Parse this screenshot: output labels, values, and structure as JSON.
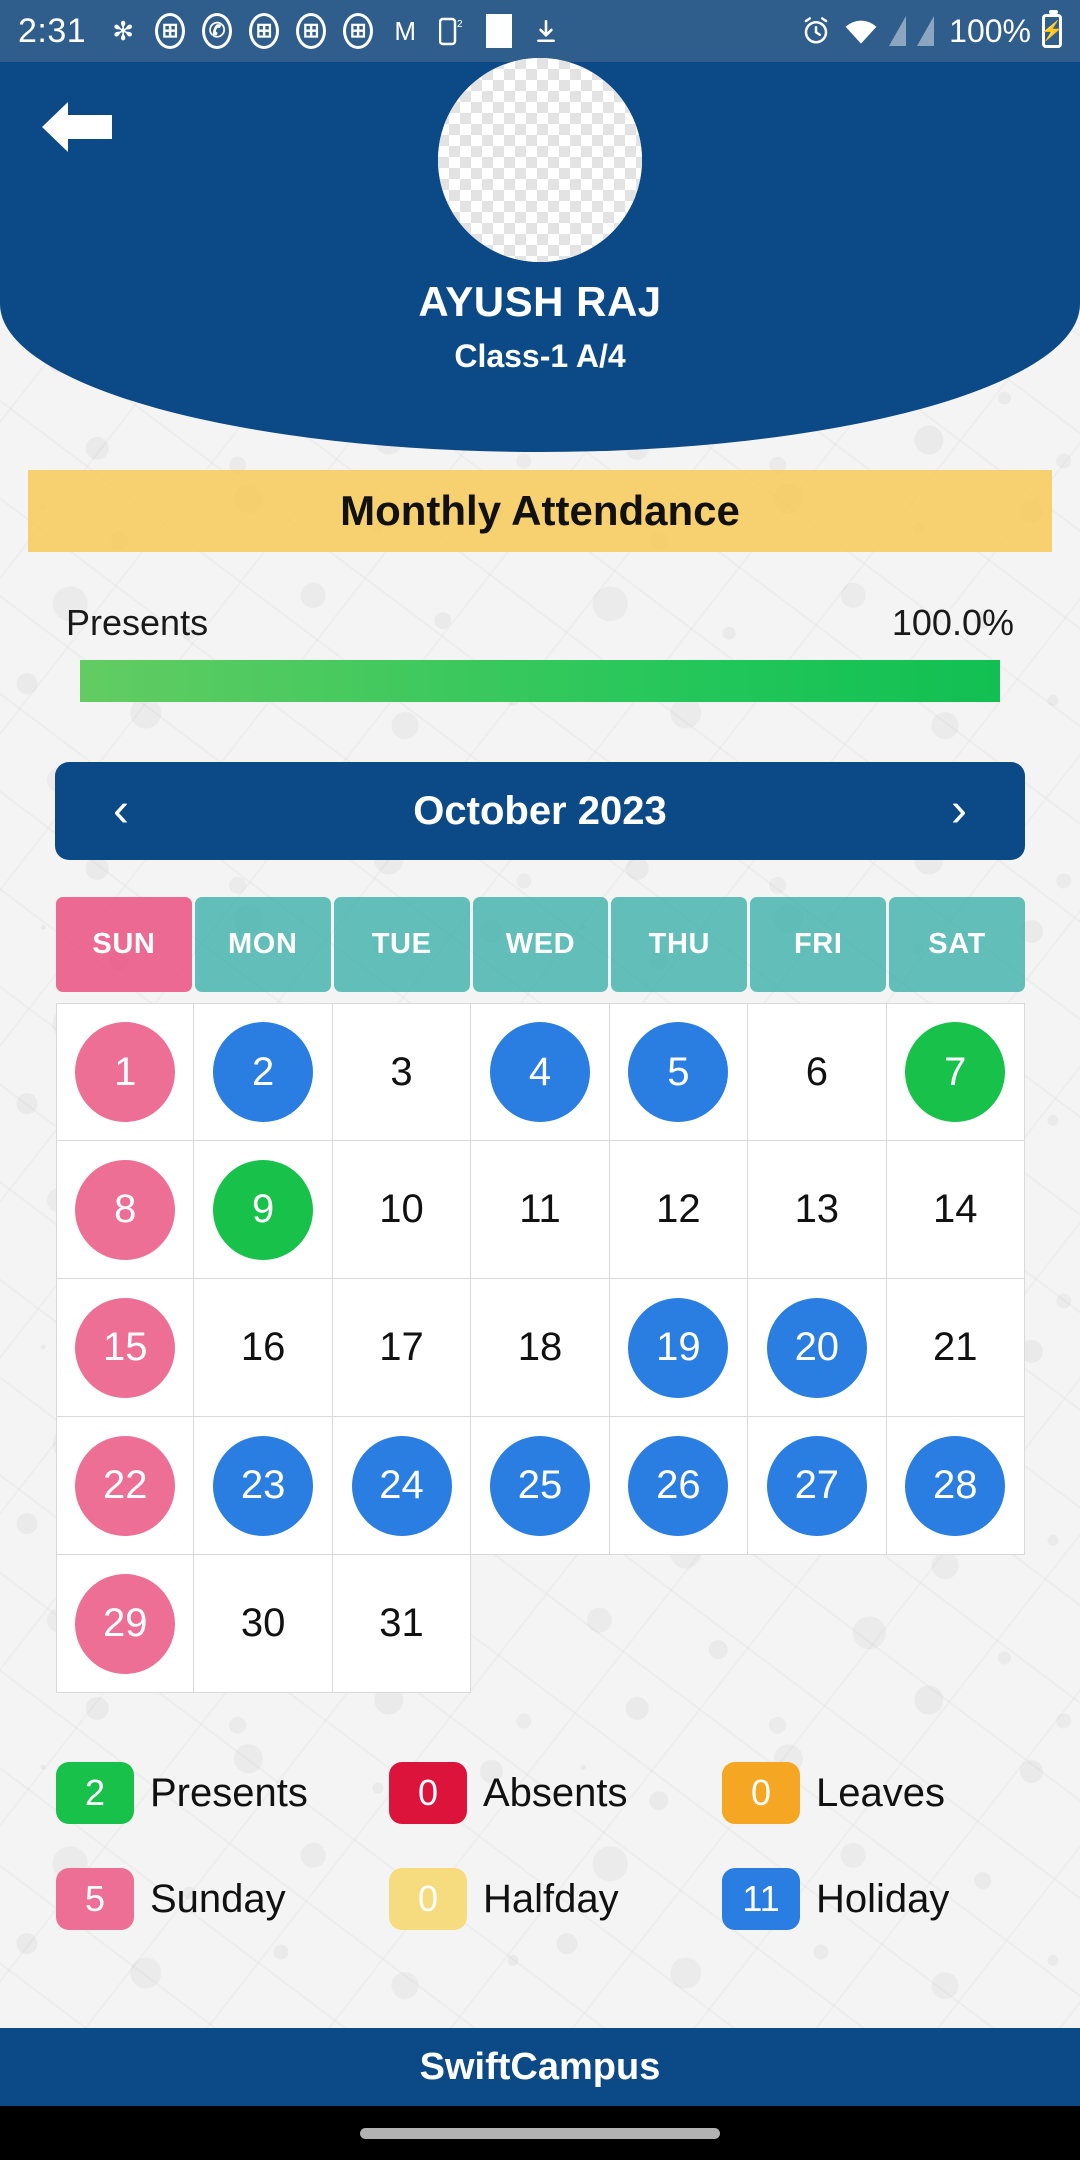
{
  "statusbar": {
    "clock": "2:31",
    "battery_percent": "100%",
    "icons": [
      "slack-icon",
      "app-oval-icon",
      "whatsapp-icon",
      "app-oval-icon",
      "app-oval-icon",
      "app-oval-icon",
      "gmail-icon",
      "exit-badge-icon",
      "white-square-icon",
      "download-icon",
      "alarm-icon",
      "wifi-icon",
      "signal-bar-icon",
      "signal-bar-icon",
      "battery-icon"
    ]
  },
  "header": {
    "back_icon": "back-arrow-icon",
    "avatar_alt": "student-photo",
    "student_name": "AYUSH RAJ",
    "student_class": "Class-1 A/4"
  },
  "banner": {
    "title": "Monthly Attendance"
  },
  "attendance": {
    "label": "Presents",
    "percent_text": "100.0%",
    "percent_value": 100
  },
  "month_nav": {
    "prev_icon": "chevron-left-icon",
    "next_icon": "chevron-right-icon",
    "month_label": "October 2023"
  },
  "calendar": {
    "day_headers": [
      "SUN",
      "MON",
      "TUE",
      "WED",
      "THU",
      "FRI",
      "SAT"
    ],
    "weeks": [
      [
        {
          "day": "1",
          "status": "sunday"
        },
        {
          "day": "2",
          "status": "holiday"
        },
        {
          "day": "3",
          "status": "none"
        },
        {
          "day": "4",
          "status": "holiday"
        },
        {
          "day": "5",
          "status": "holiday"
        },
        {
          "day": "6",
          "status": "none"
        },
        {
          "day": "7",
          "status": "present"
        }
      ],
      [
        {
          "day": "8",
          "status": "sunday"
        },
        {
          "day": "9",
          "status": "present"
        },
        {
          "day": "10",
          "status": "none"
        },
        {
          "day": "11",
          "status": "none"
        },
        {
          "day": "12",
          "status": "none"
        },
        {
          "day": "13",
          "status": "none"
        },
        {
          "day": "14",
          "status": "none"
        }
      ],
      [
        {
          "day": "15",
          "status": "sunday"
        },
        {
          "day": "16",
          "status": "none"
        },
        {
          "day": "17",
          "status": "none"
        },
        {
          "day": "18",
          "status": "none"
        },
        {
          "day": "19",
          "status": "holiday"
        },
        {
          "day": "20",
          "status": "holiday"
        },
        {
          "day": "21",
          "status": "none"
        }
      ],
      [
        {
          "day": "22",
          "status": "sunday"
        },
        {
          "day": "23",
          "status": "holiday"
        },
        {
          "day": "24",
          "status": "holiday"
        },
        {
          "day": "25",
          "status": "holiday"
        },
        {
          "day": "26",
          "status": "holiday"
        },
        {
          "day": "27",
          "status": "holiday"
        },
        {
          "day": "28",
          "status": "holiday"
        }
      ],
      [
        {
          "day": "29",
          "status": "sunday"
        },
        {
          "day": "30",
          "status": "none"
        },
        {
          "day": "31",
          "status": "none"
        },
        {
          "day": "",
          "status": "empty"
        },
        {
          "day": "",
          "status": "empty"
        },
        {
          "day": "",
          "status": "empty"
        },
        {
          "day": "",
          "status": "empty"
        }
      ]
    ]
  },
  "legend": [
    {
      "count": "2",
      "label": "Presents",
      "key": "present"
    },
    {
      "count": "0",
      "label": "Absents",
      "key": "absent"
    },
    {
      "count": "0",
      "label": "Leaves",
      "key": "leave"
    },
    {
      "count": "5",
      "label": "Sunday",
      "key": "sunday"
    },
    {
      "count": "0",
      "label": "Halfday",
      "key": "halfday"
    },
    {
      "count": "11",
      "label": "Holiday",
      "key": "holiday"
    }
  ],
  "footer": {
    "brand": "SwiftCampus"
  },
  "colors": {
    "brand_blue": "#0b4a87",
    "banner_yellow": "#f7c74f",
    "present_green": "#17c14a",
    "absent_red": "#dc143c",
    "leave_orange": "#f5a623",
    "sunday_pink": "#ee6f96",
    "halfday_yellow": "#f7dc7f",
    "holiday_blue": "#2a7de1",
    "dow_teal": "#39aea6"
  }
}
